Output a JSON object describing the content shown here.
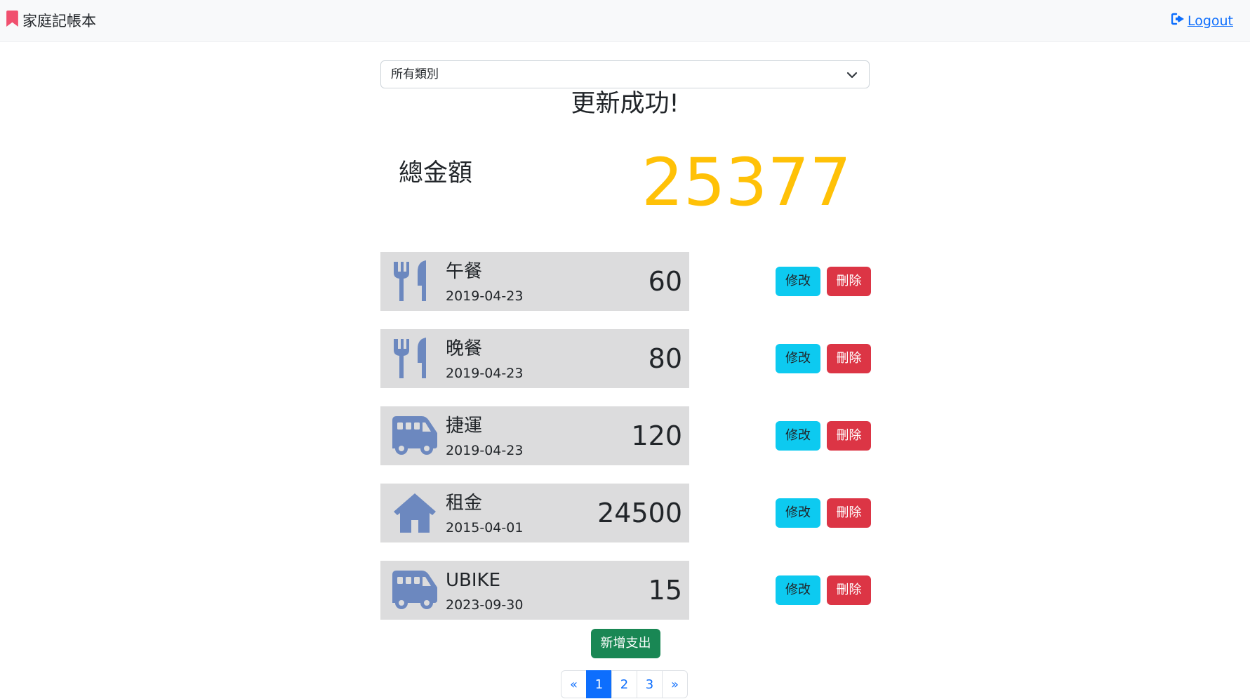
{
  "navbar": {
    "brand": "家庭記帳本",
    "logout": "Logout"
  },
  "filter": {
    "selected": "所有類別"
  },
  "message": "更新成功!",
  "summary": {
    "label": "總金額",
    "value": "25377"
  },
  "expenses": [
    {
      "icon": "utensils-icon",
      "name": "午餐",
      "date": "2019-04-23",
      "amount": "60",
      "edit": "修改",
      "delete": "刪除"
    },
    {
      "icon": "utensils-icon",
      "name": "晚餐",
      "date": "2019-04-23",
      "amount": "80",
      "edit": "修改",
      "delete": "刪除"
    },
    {
      "icon": "shuttle-van-icon",
      "name": "捷運",
      "date": "2019-04-23",
      "amount": "120",
      "edit": "修改",
      "delete": "刪除"
    },
    {
      "icon": "home-icon",
      "name": "租金",
      "date": "2015-04-01",
      "amount": "24500",
      "edit": "修改",
      "delete": "刪除"
    },
    {
      "icon": "shuttle-van-icon",
      "name": "UBIKE",
      "date": "2023-09-30",
      "amount": "15",
      "edit": "修改",
      "delete": "刪除"
    }
  ],
  "add_button": "新增支出",
  "pagination": {
    "prev": "«",
    "pages": [
      "1",
      "2",
      "3"
    ],
    "active": "1",
    "next": "»"
  },
  "colors": {
    "accent": "#ffc107",
    "icon": "#6c88bf",
    "edit_button": "#0dcaf0",
    "delete_button": "#dc3545",
    "add_button": "#198754",
    "brand_icon": "#f0506e",
    "link": "#0d6efd"
  }
}
